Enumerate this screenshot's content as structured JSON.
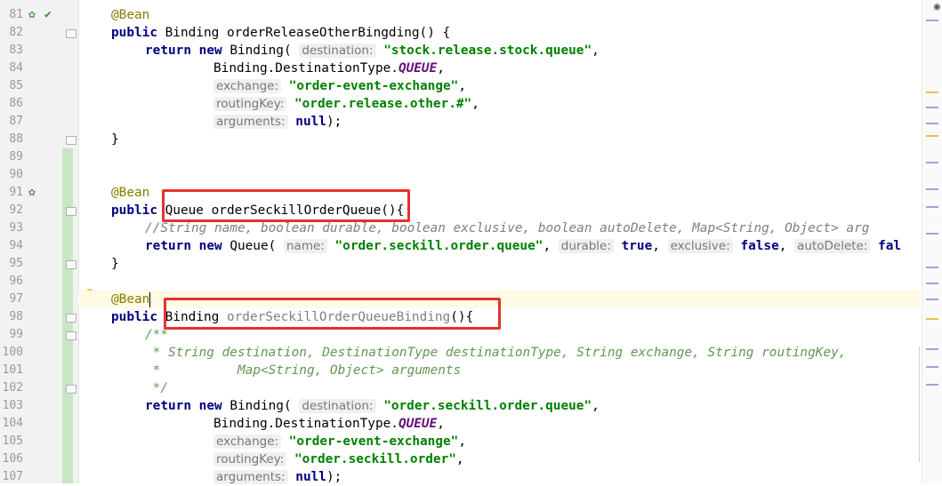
{
  "line_numbers": [
    "81",
    "82",
    "83",
    "84",
    "85",
    "86",
    "87",
    "88",
    "89",
    "90",
    "91",
    "92",
    "93",
    "94",
    "95",
    "96",
    "97",
    "98",
    "99",
    "100",
    "101",
    "102",
    "103",
    "104",
    "105",
    "106",
    "107"
  ],
  "code": {
    "l81_ann": "@Bean",
    "l82_public": "public",
    "l82_rest": " Binding orderReleaseOtherBingding() {",
    "l83_return": "return",
    "l83_new": "new",
    "l83_type": " Binding(",
    "l83_hint": "destination:",
    "l83_str": "\"stock.release.stock.queue\"",
    "l83_end": ",",
    "l84_pre": "Binding.DestinationType.",
    "l84_const": "QUEUE",
    "l84_end": ",",
    "l85_hint": "exchange:",
    "l85_str": "\"order-event-exchange\"",
    "l85_end": ",",
    "l86_hint": "routingKey:",
    "l86_str": "\"order.release.other.#\"",
    "l86_end": ",",
    "l87_hint": "arguments:",
    "l87_null": "null",
    "l87_end": ");",
    "l88_brace": "}",
    "l91_ann": "@Bean",
    "l92_public": "public",
    "l92_rest": " Queue orderSeckillOrderQueue(){",
    "l93_comment": "//String name, boolean durable, boolean exclusive, boolean autoDelete, Map<String, Object> arg",
    "l94_return": "return",
    "l94_new": "new",
    "l94_type": " Queue(",
    "l94_hint1": "name:",
    "l94_str": "\"order.seckill.order.queue\"",
    "l94_sep1": ",",
    "l94_hint2": "durable:",
    "l94_true": "true",
    "l94_sep2": ",",
    "l94_hint3": "exclusive:",
    "l94_false": "false",
    "l94_sep3": ",",
    "l94_hint4": "autoDelete:",
    "l94_tail": "fal",
    "l95_brace": "}",
    "l97_ann": "@Bean",
    "l98_public": "public",
    "l98_type": " Binding ",
    "l98_method": "orderSeckillOrderQueueBinding",
    "l98_end": "(){",
    "l99_doc": "/**",
    "l100_doc": " * String destination, DestinationType destinationType, String exchange, String routingKey,",
    "l101_doc": " *          Map<String, Object> arguments",
    "l102_doc": " */",
    "l103_return": "return",
    "l103_new": "new",
    "l103_type": " Binding(",
    "l103_hint": "destination:",
    "l103_str": "\"order.seckill.order.queue\"",
    "l103_end": ",",
    "l104_pre": "Binding.DestinationType.",
    "l104_const": "QUEUE",
    "l104_end": ",",
    "l105_hint": "exchange:",
    "l105_str": "\"order-event-exchange\"",
    "l105_end": ",",
    "l106_hint": "routingKey:",
    "l106_str": "\"order.seckill.order\"",
    "l106_end": ",",
    "l107_hint": "arguments:",
    "l107_null": "null",
    "l107_end": ");"
  },
  "colors": {
    "highlight_box": "#e4322b",
    "string": "#008000",
    "keyword": "#000080",
    "annotation": "#808000"
  },
  "icons": [
    "spring-bean-icon",
    "navigate-icon",
    "intention-bulb-icon",
    "eye-icon"
  ]
}
